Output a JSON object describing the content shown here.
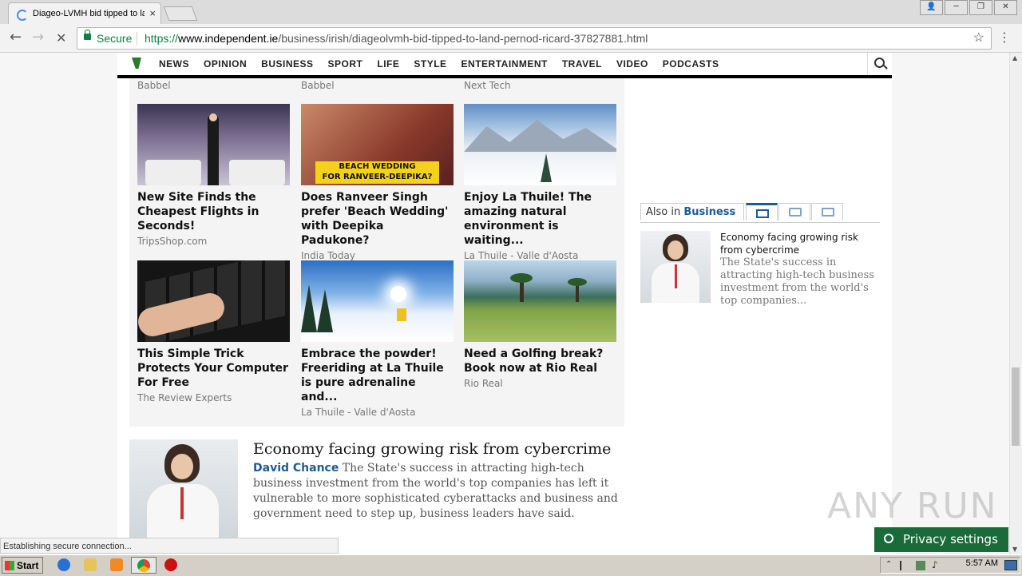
{
  "browser": {
    "tab_title": "Diageo-LVMH bid tipped to land",
    "tab_close": "×",
    "secure_label": "Secure",
    "url_scheme": "https://",
    "url_host": "www.independent.ie",
    "url_path": "/business/irish/diageolvmh-bid-tipped-to-land-pernod-ricard-37827881.html",
    "back": "←",
    "forward": "→",
    "stop": "✕",
    "star": "☆",
    "menu": "⋮",
    "window_buttons": [
      "👤",
      "─",
      "❐",
      "✕"
    ]
  },
  "nav": {
    "items": [
      "NEWS",
      "OPINION",
      "BUSINESS",
      "SPORT",
      "LIFE",
      "STYLE",
      "ENTERTAINMENT",
      "TRAVEL",
      "VIDEO",
      "PODCASTS"
    ]
  },
  "sponsored": {
    "top_sources": [
      "Babbel",
      "Babbel",
      "Next Tech"
    ],
    "cards": [
      {
        "title": "New Site Finds the Cheapest Flights in Seconds!",
        "source": "TripsShop.com",
        "overlay": ""
      },
      {
        "title": "Does Ranveer Singh prefer 'Beach Wedding' with Deepika Padukone?",
        "source": "India Today",
        "overlay1": "BEACH WEDDING",
        "overlay2": "FOR RANVEER-DEEPIKA?"
      },
      {
        "title": "Enjoy La Thuile! The amazing natural environment is waiting...",
        "source": "La Thuile - Valle d'Aosta",
        "overlay": ""
      },
      {
        "title": "This Simple Trick Protects Your Computer For Free",
        "source": "The Review Experts",
        "overlay": ""
      },
      {
        "title": "Embrace the powder! Freeriding at La Thuile is pure adrenaline and...",
        "source": "La Thuile - Valle d'Aosta",
        "overlay": ""
      },
      {
        "title": "Need a Golfing break? Book now at Rio Real",
        "source": "Rio Real",
        "overlay": ""
      }
    ]
  },
  "teaser": {
    "title": "Economy facing growing risk from cybercrime",
    "author": "David Chance",
    "body": " The State's success in attracting high-tech business investment from the world's top companies has left it vulnerable to more sophisticated cyberattacks and business and government need to step up, business leaders have said."
  },
  "sidebar": {
    "also_in": "Also in",
    "section": "Business",
    "story_title": "Economy facing growing risk from cybercrime",
    "story_body": "The State's success in attracting high-tech business investment from the world's top companies..."
  },
  "status_bar": "Establishing secure connection...",
  "privacy_button": "Privacy settings",
  "watermark": "ANY RUN",
  "taskbar": {
    "start": "Start",
    "clock": "5:57 AM"
  }
}
